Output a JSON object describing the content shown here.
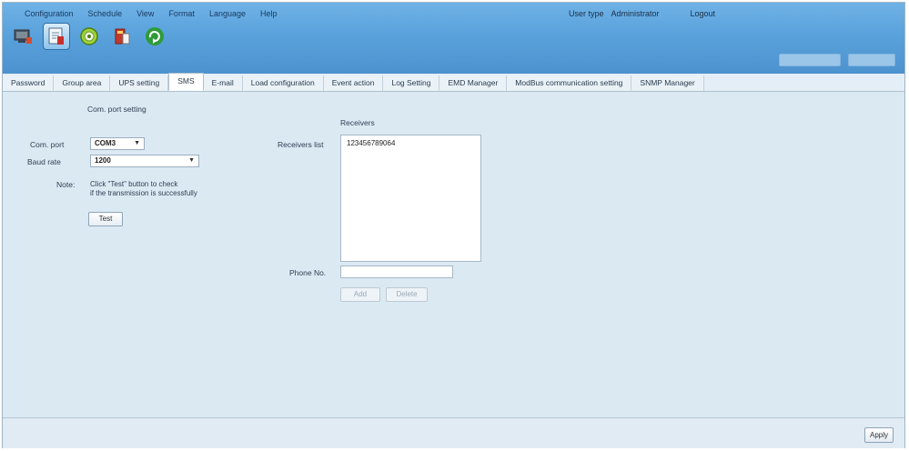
{
  "menu": [
    "Configuration",
    "Schedule",
    "View",
    "Format",
    "Language",
    "Help"
  ],
  "user": {
    "type_label": "User type",
    "type_value": "Administrator",
    "logout": "Logout"
  },
  "toolbar": [
    "monitor-icon",
    "configuration-icon",
    "schedule-icon",
    "ups-icon",
    "refresh-icon"
  ],
  "tabs": [
    "Password",
    "Group area",
    "UPS setting",
    "SMS",
    "E-mail",
    "Load configuration",
    "Event action",
    "Log Setting",
    "EMD Manager",
    "ModBus communication setting",
    "SNMP Manager"
  ],
  "active_tab": "SMS",
  "com_setting": {
    "heading": "Com. port setting",
    "com_port_label": "Com. port",
    "com_port_value": "COM3",
    "baud_label": "Baud rate",
    "baud_value": "1200",
    "note_label": "Note:",
    "note_line1": "Click  \"Test\"  button to check",
    "note_line2": "if the transmission is successfully",
    "test_button": "Test"
  },
  "receivers": {
    "heading": "Receivers",
    "list_label": "Receivers list",
    "entries": [
      "123456789064"
    ],
    "phone_label": "Phone No.",
    "phone_value": "",
    "add_button": "Add",
    "delete_button": "Delete"
  },
  "footer": {
    "apply_button": "Apply"
  },
  "colors": {
    "header": "#5aa2dc",
    "background": "#dbe9f3",
    "tab_bar": "#e4eef6"
  }
}
